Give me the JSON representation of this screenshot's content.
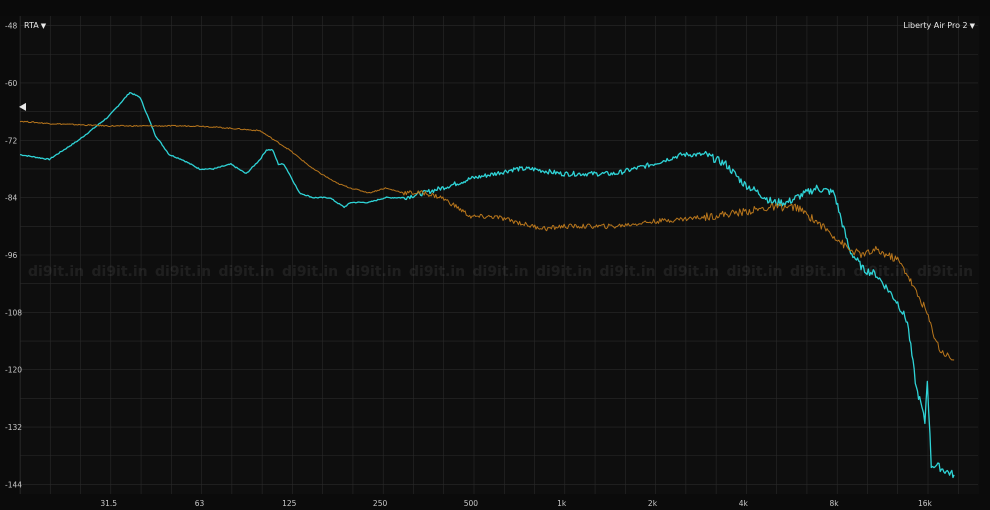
{
  "header": {
    "mode_label": "RTA",
    "device_label": "Liberty Air Pro 2",
    "caret": "▼"
  },
  "watermark": "di9it.in",
  "colors": {
    "background": "#0b0b0b",
    "grid": "#2a2a2a",
    "series_cyan": "#2fd3d6",
    "series_amber": "#b8761c"
  },
  "chart_data": {
    "type": "line",
    "x_scale": "log",
    "xlim": [
      16,
      24000
    ],
    "ylim": [
      -146,
      -46
    ],
    "x_ticks": [
      {
        "label": "31.5",
        "value": 31.5
      },
      {
        "label": "63",
        "value": 63
      },
      {
        "label": "125",
        "value": 125
      },
      {
        "label": "250",
        "value": 250
      },
      {
        "label": "500",
        "value": 500
      },
      {
        "label": "1k",
        "value": 1000
      },
      {
        "label": "2k",
        "value": 2000
      },
      {
        "label": "4k",
        "value": 4000
      },
      {
        "label": "8k",
        "value": 8000
      },
      {
        "label": "16k",
        "value": 16000
      }
    ],
    "y_ticks": [
      -48,
      -60,
      -72,
      -84,
      -96,
      -108,
      -120,
      -132,
      -144
    ],
    "series": [
      {
        "color": "#2fd3d6",
        "x": [
          16,
          20,
          25,
          31.5,
          37,
          40,
          45,
          50,
          55,
          63,
          70,
          80,
          90,
          100,
          105,
          110,
          115,
          120,
          125,
          135,
          150,
          170,
          190,
          200,
          230,
          260,
          300,
          350,
          400,
          450,
          500,
          600,
          700,
          800,
          1000,
          1200,
          1500,
          2000,
          2500,
          3000,
          3500,
          4000,
          4500,
          5000,
          5600,
          6000,
          7000,
          8000,
          9000,
          10000,
          11000,
          12000,
          13000,
          14000,
          15000,
          15500,
          16000,
          16300,
          16800,
          17500,
          18500,
          20000
        ],
        "y": [
          -75,
          -76,
          -72,
          -67,
          -62,
          -63,
          -71,
          -75,
          -76,
          -78,
          -78,
          -77,
          -79,
          -76,
          -74,
          -74,
          -77,
          -77,
          -79,
          -83,
          -84,
          -84,
          -86,
          -85,
          -85,
          -84,
          -84,
          -83,
          -82,
          -81,
          -80,
          -79,
          -78,
          -78,
          -79,
          -79,
          -79,
          -77,
          -75,
          -75,
          -77,
          -81,
          -83,
          -85,
          -85,
          -84,
          -82,
          -83,
          -95,
          -99,
          -100,
          -103,
          -106,
          -110,
          -124,
          -127,
          -131,
          -122,
          -140,
          -140,
          -141,
          -142
        ]
      },
      {
        "color": "#b8761c",
        "x": [
          16,
          20,
          31.5,
          50,
          63,
          80,
          100,
          125,
          150,
          180,
          200,
          230,
          260,
          300,
          350,
          400,
          450,
          500,
          600,
          700,
          800,
          900,
          1000,
          1200,
          1500,
          2000,
          2500,
          3000,
          4000,
          5000,
          5600,
          6000,
          7000,
          8000,
          9000,
          10000,
          11000,
          12000,
          13000,
          14000,
          15000,
          16000,
          17000,
          18000,
          19000,
          20000
        ],
        "y": [
          -68,
          -68.5,
          -69,
          -69,
          -69,
          -69.5,
          -70,
          -74,
          -78,
          -81,
          -82,
          -83,
          -82,
          -83,
          -83,
          -84,
          -86,
          -88,
          -88,
          -89,
          -90,
          -90.5,
          -90,
          -90,
          -90,
          -89,
          -88.5,
          -88,
          -87,
          -86,
          -86,
          -86,
          -89,
          -92,
          -95,
          -96,
          -95,
          -96,
          -97,
          -100,
          -104,
          -107,
          -112,
          -116,
          -117,
          -118
        ]
      }
    ]
  }
}
